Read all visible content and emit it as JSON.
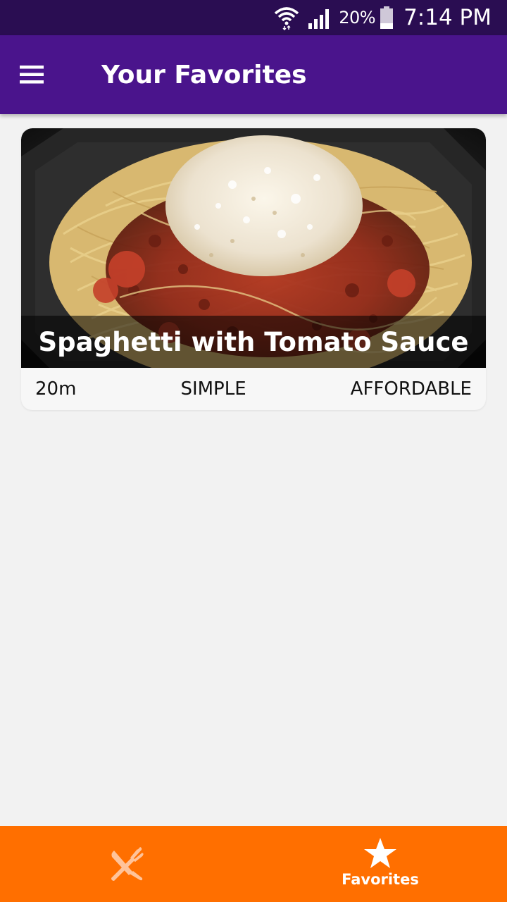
{
  "status_bar": {
    "battery_percent": "20%",
    "time": "7:14 PM",
    "icons": [
      "wifi-icon",
      "signal-icon",
      "battery-icon"
    ]
  },
  "app_bar": {
    "title": "Your Favorites",
    "menu_icon": "menu-icon"
  },
  "favorites": [
    {
      "title": "Spaghetti with Tomato Sauce",
      "duration": "20m",
      "complexity": "SIMPLE",
      "affordability": "AFFORDABLE"
    }
  ],
  "tab_bar": {
    "tabs": [
      {
        "icon": "utensils-icon",
        "label": "",
        "active": false
      },
      {
        "icon": "star-icon",
        "label": "Favorites",
        "active": true
      }
    ]
  },
  "colors": {
    "status_bar": "#2a0d52",
    "app_bar": "#4a148c",
    "tab_bar": "#ff6f00",
    "inactive_tab_icon": "#ffc39a",
    "background": "#f2f2f2"
  }
}
